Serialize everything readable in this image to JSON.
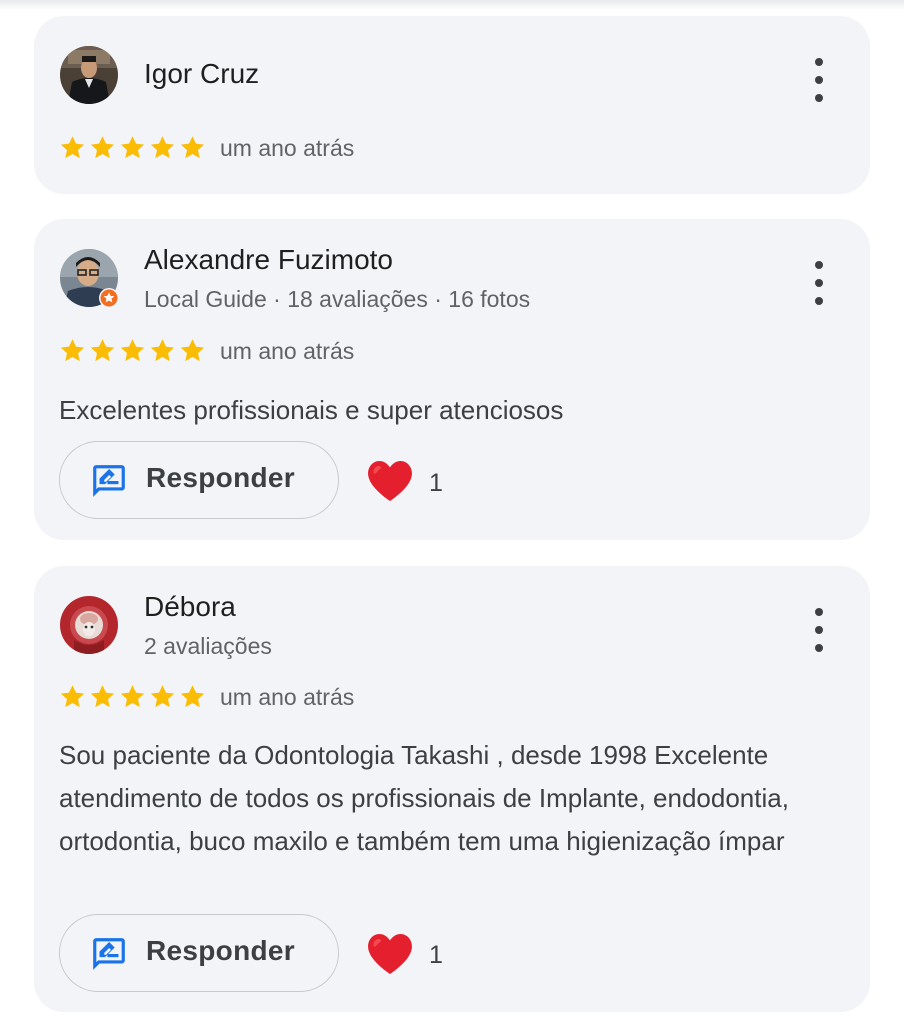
{
  "reviews": [
    {
      "name": "Igor Cruz",
      "meta": "",
      "rating": 5,
      "time": "um ano atrás",
      "text": "",
      "reply_label": "",
      "likes": ""
    },
    {
      "name": "Alexandre Fuzimoto",
      "meta": "Local Guide · 18 avaliações · 16 fotos",
      "rating": 5,
      "time": "um ano atrás",
      "text": "Excelentes profissionais e super atenciosos",
      "reply_label": "Responder",
      "likes": "1"
    },
    {
      "name": "Débora",
      "meta": "2 avaliações",
      "rating": 5,
      "time": "um ano atrás",
      "text": "Sou paciente da Odontologia Takashi , desde 1998 Excelente atendimento de todos os profissionais de Implante, endodontia, ortodontia, buco maxilo e também tem uma higienização ímpar",
      "reply_label": "Responder",
      "likes": "1"
    }
  ],
  "colors": {
    "star": "#fbbc04",
    "reply_icon": "#1a73e8",
    "heart": "#e5202e",
    "local_guide_badge": "#f26f21",
    "card_bg": "#f3f4f7"
  },
  "icons": {
    "more": "more-vert-icon",
    "reply": "reply-edit-icon",
    "like": "heart-icon",
    "star": "star-icon"
  }
}
